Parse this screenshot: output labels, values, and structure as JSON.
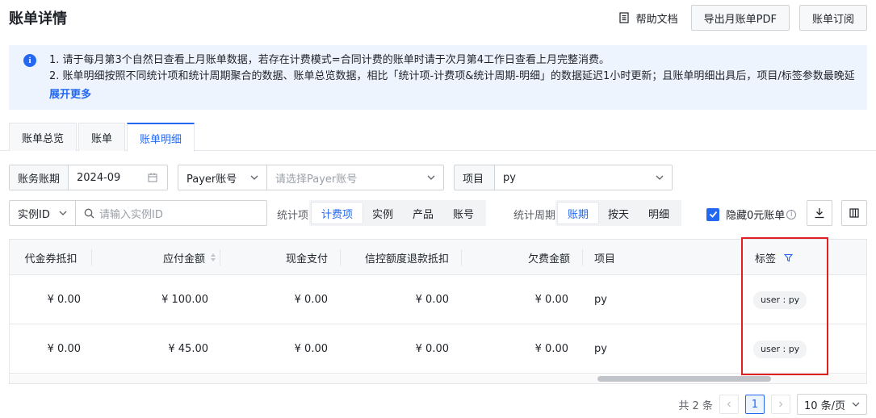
{
  "page": {
    "title": "账单详情"
  },
  "top_actions": {
    "help": "帮助文档",
    "export": "导出月账单PDF",
    "subscribe": "账单订阅"
  },
  "notice": {
    "line1": "1. 请于每月第3个自然日查看上月账单数据，若存在计费模式=合同计费的账单时请于次月第4工作日查看上月完整消费。",
    "line2": "2. 账单明细按照不同统计项和统计周期聚合的数据、账单总览数据，相比「统计项-计费项&统计周期-明细」的数据延迟1小时更新；且账单明细出具后，项目/标签参数最晚延",
    "more": "展开更多"
  },
  "tabs": [
    {
      "label": "账单总览",
      "active": false
    },
    {
      "label": "账单",
      "active": false
    },
    {
      "label": "账单明细",
      "active": true
    }
  ],
  "filters": {
    "period_label": "账务账期",
    "period_value": "2024-09",
    "payer_select": "Payer账号",
    "payer_placeholder": "请选择Payer账号",
    "project_label": "项目",
    "project_value": "py",
    "instance_select": "实例ID",
    "instance_placeholder": "请输入实例ID",
    "stat_item_label": "统计项",
    "stat_items": [
      "计费项",
      "实例",
      "产品",
      "账号"
    ],
    "stat_period_label": "统计周期",
    "stat_periods": [
      "账期",
      "按天",
      "明细"
    ],
    "hide_zero_label": "隐藏0元账单",
    "hide_zero_checked": true
  },
  "table": {
    "columns": [
      "代金券抵扣",
      "应付金额",
      "现金支付",
      "信控额度退款抵扣",
      "欠费金额",
      "项目",
      "标签"
    ],
    "rows": [
      {
        "voucher": "¥ 0.00",
        "payable": "¥ 100.00",
        "cash": "¥ 0.00",
        "credit": "¥ 0.00",
        "arrears": "¥ 0.00",
        "project": "py",
        "tag": "user : py"
      },
      {
        "voucher": "¥ 0.00",
        "payable": "¥ 45.00",
        "cash": "¥ 0.00",
        "credit": "¥ 0.00",
        "arrears": "¥ 0.00",
        "project": "py",
        "tag": "user : py"
      }
    ]
  },
  "pagination": {
    "total": "共 2 条",
    "current_page": "1",
    "page_size": "10 条/页"
  },
  "colors": {
    "accent": "#2468f2",
    "highlight": "#e02020",
    "notice_bg": "#eef4fe"
  }
}
